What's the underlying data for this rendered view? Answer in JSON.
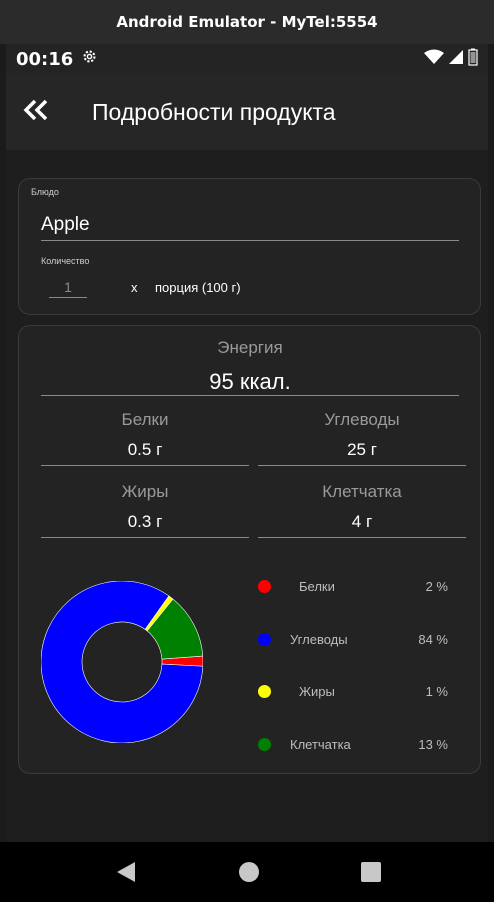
{
  "window": {
    "title": "Android Emulator - MyTel:5554"
  },
  "status_bar": {
    "time": "00:16"
  },
  "app_bar": {
    "title": "Подробности продукта"
  },
  "dish": {
    "label": "Блюдо",
    "value": "Apple"
  },
  "quantity": {
    "label": "Количество",
    "value": "1",
    "multiplier": "x",
    "unit": "порция (100 г)"
  },
  "nutrition": {
    "energy": {
      "label": "Энергия",
      "value": "95 ккал."
    },
    "protein": {
      "label": "Белки",
      "value": "0.5 г"
    },
    "carbs": {
      "label": "Углеводы",
      "value": "25 г"
    },
    "fat": {
      "label": "Жиры",
      "value": "0.3 г"
    },
    "fiber": {
      "label": "Клетчатка",
      "value": "4 г"
    }
  },
  "legend": [
    {
      "name": "Белки",
      "percent": "2 %",
      "color": "#ff0000"
    },
    {
      "name": "Углеводы",
      "percent": "84 %",
      "color": "#0000ff"
    },
    {
      "name": "Жиры",
      "percent": "1 %",
      "color": "#ffff00"
    },
    {
      "name": "Клетчатка",
      "percent": "13 %",
      "color": "#008000"
    }
  ],
  "chart_data": {
    "type": "pie",
    "categories": [
      "Белки",
      "Углеводы",
      "Жиры",
      "Клетчатка"
    ],
    "values": [
      2,
      84,
      1,
      13
    ],
    "colors": [
      "#ff0000",
      "#0000ff",
      "#ffff00",
      "#008000"
    ],
    "title": "",
    "legend": "right"
  }
}
